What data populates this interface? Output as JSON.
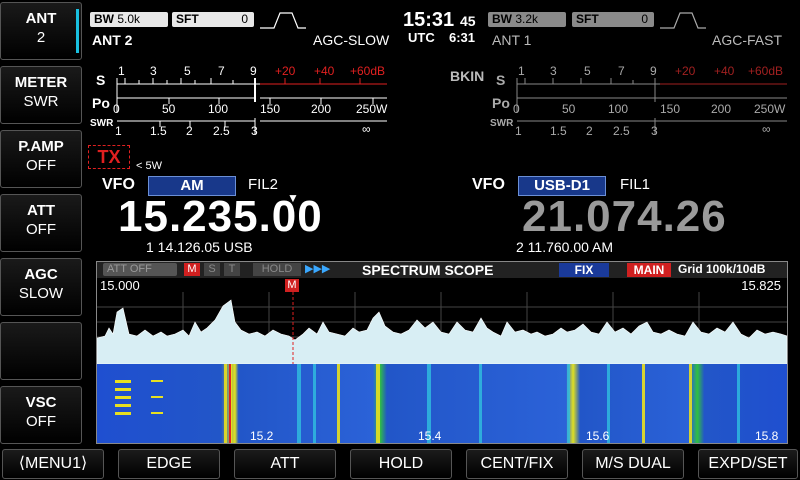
{
  "side_buttons": [
    {
      "title": "ANT",
      "value": "2"
    },
    {
      "title": "METER",
      "value": "SWR"
    },
    {
      "title": "P.AMP",
      "value": "OFF"
    },
    {
      "title": "ATT",
      "value": "OFF"
    },
    {
      "title": "AGC",
      "value": "SLOW"
    },
    {
      "title": "",
      "value": ""
    },
    {
      "title": "VSC",
      "value": "OFF"
    }
  ],
  "bottom_buttons": [
    "⟨MENU1⟩",
    "EDGE",
    "ATT",
    "HOLD",
    "CENT/FIX",
    "M/S DUAL",
    "EXPD/SET"
  ],
  "clock": {
    "time": "15:31",
    "seconds": "45",
    "utc_label": "UTC",
    "utc_time": "6:31"
  },
  "main": {
    "bw_label": "BW",
    "bw_value": "5.0k",
    "sft_label": "SFT",
    "sft_value": "0",
    "ant": "ANT 2",
    "agc": "AGC-SLOW",
    "tx": "TX",
    "power": "< 5W",
    "vfo_label": "VFO",
    "mode": "AM",
    "filter": "FIL2",
    "frequency": "15.235.00",
    "sub_line": "1  14.126.05  USB"
  },
  "sub": {
    "bw_label": "BW",
    "bw_value": "3.2k",
    "sft_label": "SFT",
    "sft_value": "0",
    "ant": "ANT 1",
    "agc": "AGC-FAST",
    "bkin": "BKIN",
    "vfo_label": "VFO",
    "mode": "USB-D1",
    "filter": "FIL1",
    "frequency": "21.074.26",
    "sub_line": "2  11.760.00  AM"
  },
  "meter": {
    "s_label": "S",
    "po_label": "Po",
    "swr_label": "SWR",
    "s_ticks": [
      "1",
      "3",
      "5",
      "7",
      "9"
    ],
    "s_plus": [
      "+20",
      "+40",
      "+60dB"
    ],
    "po_ticks": [
      "0",
      "50",
      "100",
      "150",
      "200",
      "250W"
    ],
    "swr_ticks": [
      "1",
      "1.5",
      "2",
      "2.5",
      "3",
      "∞"
    ]
  },
  "scope": {
    "att": "ATT OFF",
    "m": "M",
    "s": "S",
    "t": "T",
    "hold": "HOLD",
    "arrows": "▶▶▶",
    "title": "SPECTRUM  SCOPE",
    "fix": "FIX",
    "main": "MAIN",
    "grid": "Grid 100k/10dB",
    "left_freq": "15.000",
    "right_freq": "15.825",
    "marker": "M",
    "axis": [
      "15.2",
      "15.4",
      "15.6",
      "15.8"
    ]
  }
}
